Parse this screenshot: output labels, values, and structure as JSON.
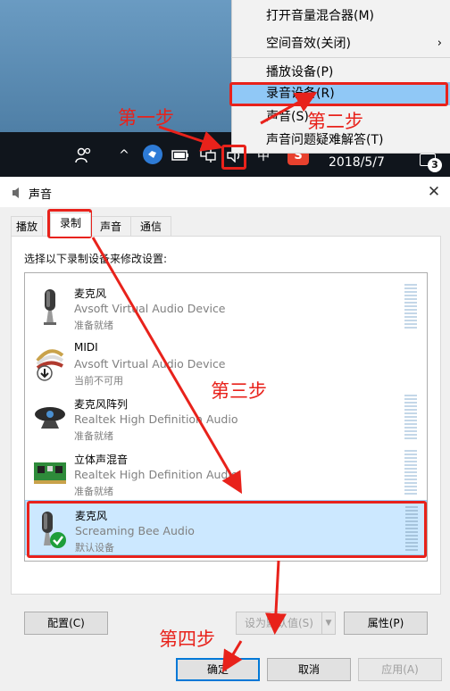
{
  "context_menu": {
    "items": [
      {
        "label": "打开音量混合器(M)"
      },
      {
        "label": "空间音效(关闭)",
        "submenu_arrow": "›"
      },
      {
        "label": "播放设备(P)"
      },
      {
        "label": "录音设备(R)"
      },
      {
        "label": "声音(S)"
      },
      {
        "label": "声音问题疑难解答(T)"
      }
    ]
  },
  "taskbar": {
    "ime_label": "中",
    "sogou_label": "S",
    "chevron": "^",
    "date": "2018/5/7",
    "notification_count": "3"
  },
  "dialog": {
    "title": "声音",
    "close_glyph": "✕",
    "tabs": [
      "播放",
      "录制",
      "声音",
      "通信"
    ],
    "active_tab": "录制",
    "instruction": "选择以下录制设备来修改设置:",
    "devices": [
      {
        "name": "麦克风",
        "description": "Avsoft Virtual Audio Device",
        "status": "准备就绪",
        "icon": "microphone-icon"
      },
      {
        "name": "MIDI",
        "description": "Avsoft Virtual Audio Device",
        "status": "当前不可用",
        "icon": "midi-cable-icon"
      },
      {
        "name": "麦克风阵列",
        "description": "Realtek High Definition Audio",
        "status": "准备就绪",
        "icon": "webcam-mic-array-icon"
      },
      {
        "name": "立体声混音",
        "description": "Realtek High Definition Audio",
        "status": "准备就绪",
        "icon": "sound-card-icon"
      },
      {
        "name": "麦克风",
        "description": "Screaming Bee Audio",
        "status": "默认设备",
        "icon": "microphone-icon",
        "selected": true
      }
    ],
    "buttons": {
      "configure": "配置(C)",
      "set_default": "设为默认值(S)",
      "properties": "属性(P)",
      "ok": "确定",
      "cancel": "取消",
      "apply": "应用(A)"
    }
  },
  "annotations": {
    "step1": "第一步",
    "step2": "第二步",
    "step3": "第三步",
    "step4": "第四步",
    "color": "#e8221b"
  }
}
